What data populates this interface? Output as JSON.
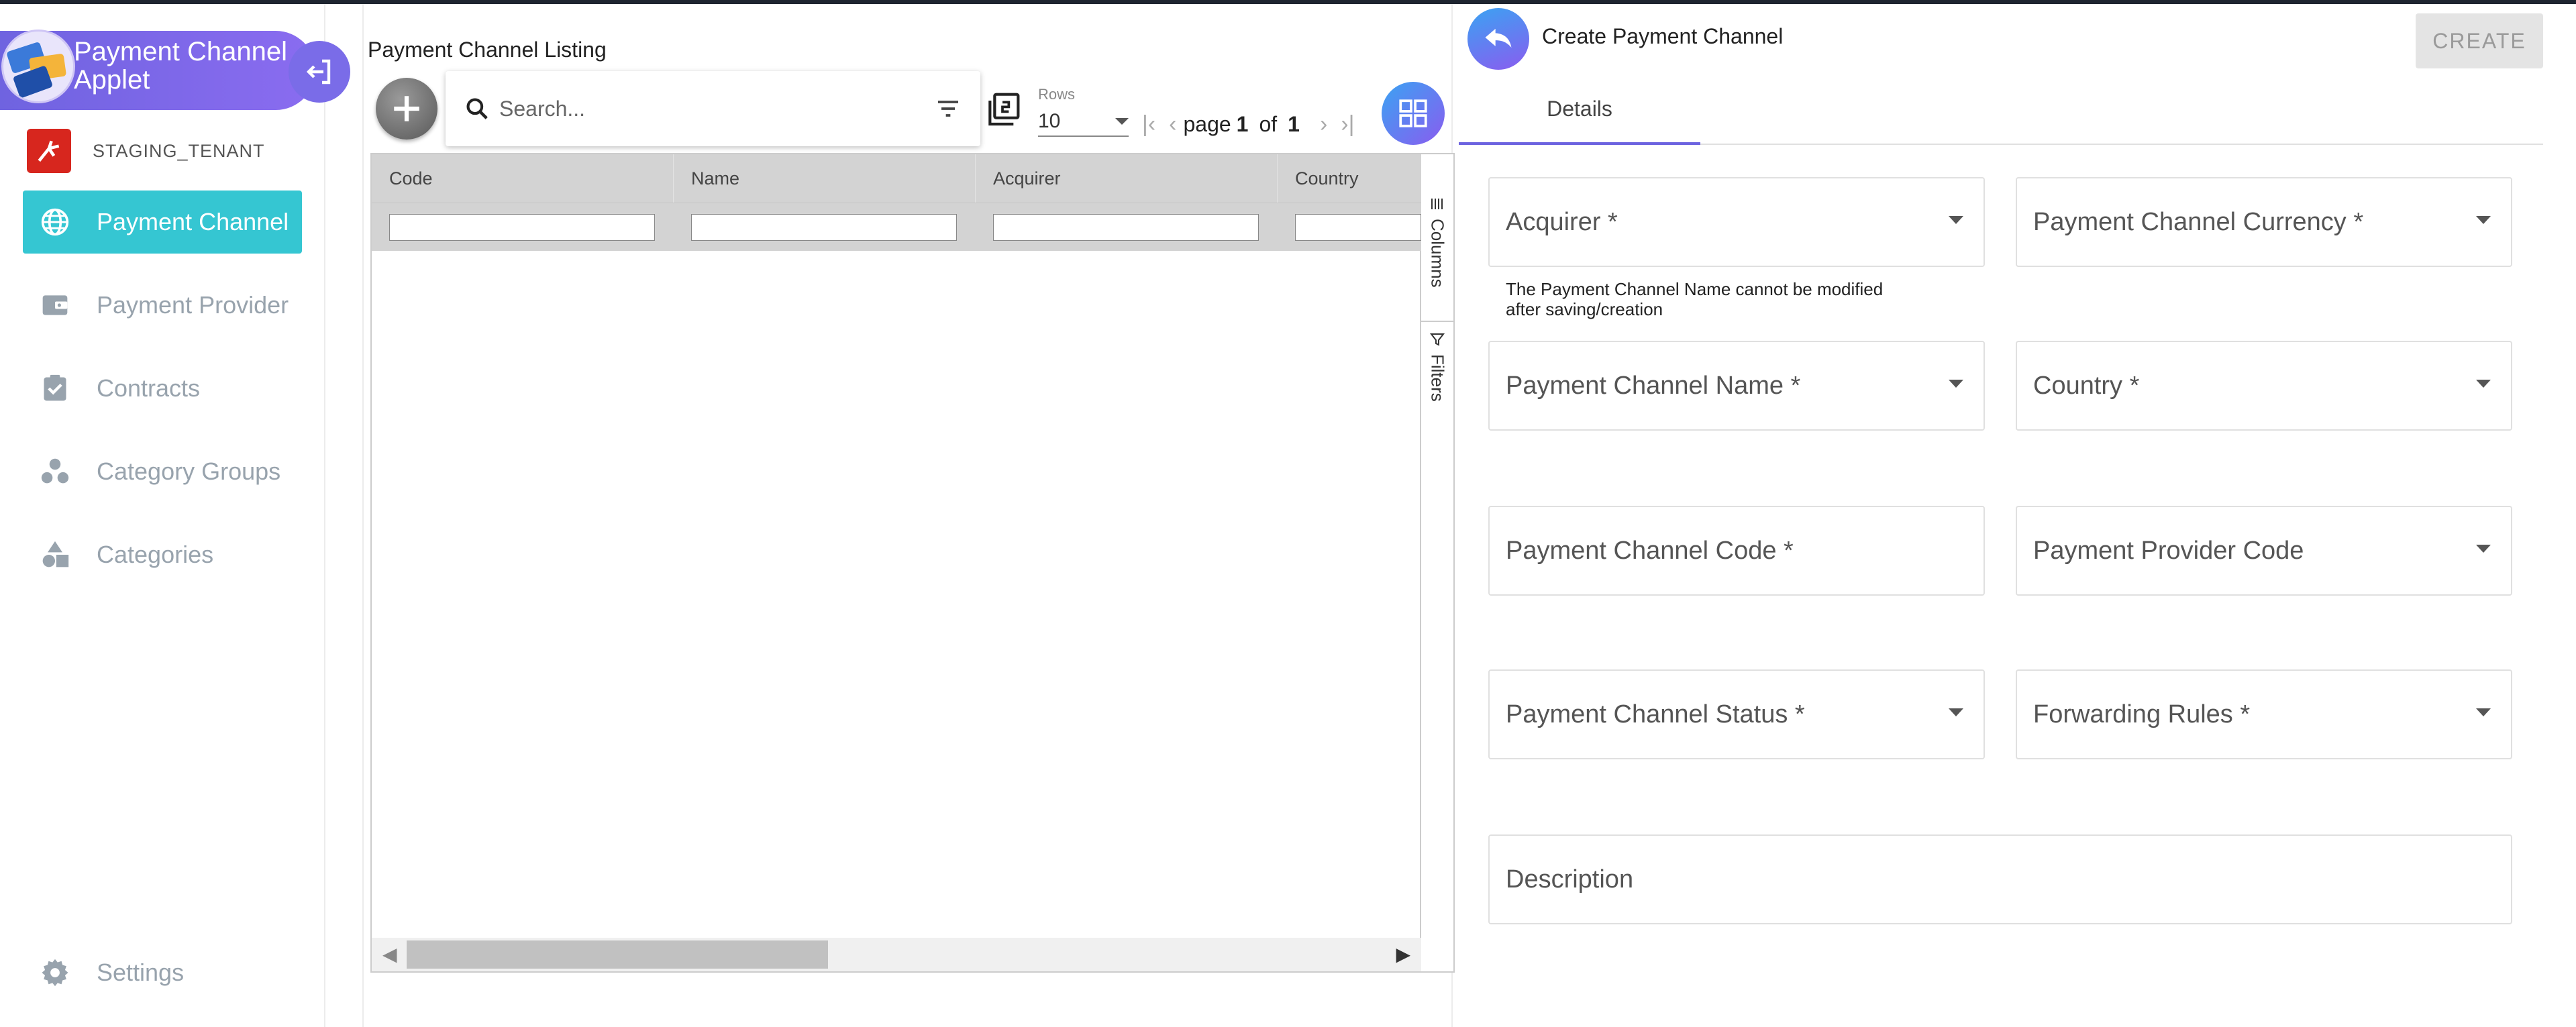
{
  "sidebar": {
    "applet_title": "Payment Channel Applet",
    "tenant_name": "STAGING_TENANT",
    "items": [
      {
        "label": "Payment Channel",
        "icon": "globe-icon",
        "active": true
      },
      {
        "label": "Payment Provider",
        "icon": "wallet-icon",
        "active": false
      },
      {
        "label": "Contracts",
        "icon": "clipboard-check-icon",
        "active": false
      },
      {
        "label": "Category Groups",
        "icon": "category-groups-icon",
        "active": false
      },
      {
        "label": "Categories",
        "icon": "shapes-icon",
        "active": false
      }
    ],
    "settings_label": "Settings"
  },
  "listing": {
    "title": "Payment Channel Listing",
    "search_placeholder": "Search...",
    "rows_label": "Rows",
    "rows_value": "10",
    "page_prefix": "page",
    "page_current": "1",
    "page_of": "of",
    "page_total": "1",
    "columns": [
      "Code",
      "Name",
      "Acquirer",
      "Country"
    ],
    "side_tabs": [
      "Columns",
      "Filters"
    ]
  },
  "form": {
    "title": "Create Payment Channel",
    "create_label": "CREATE",
    "tab_details": "Details",
    "helper_text": "The Payment Channel Name cannot be modified after saving/creation",
    "fields": {
      "acquirer": "Acquirer *",
      "currency": "Payment Channel Currency *",
      "name": "Payment Channel Name *",
      "country": "Country *",
      "code": "Payment Channel Code *",
      "provider_code": "Payment Provider Code",
      "status": "Payment Channel Status *",
      "forwarding_rules": "Forwarding Rules *",
      "description": "Description"
    }
  },
  "colors": {
    "accent_purple": "#6f63e0",
    "active_nav": "#35c6d2",
    "tenant_red": "#d7261e"
  }
}
